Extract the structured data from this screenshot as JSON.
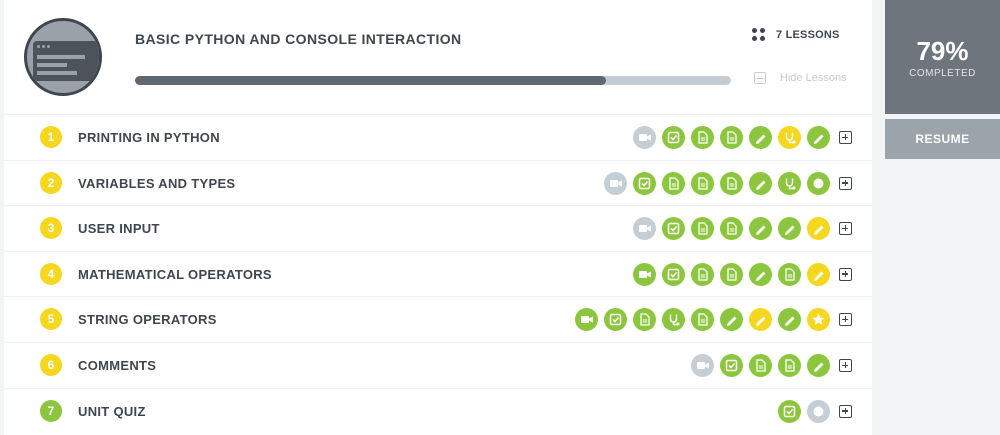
{
  "course": {
    "title": "BASIC PYTHON AND CONSOLE INTERACTION",
    "lessons_label": "7 LESSONS",
    "hide_label": "Hide Lessons",
    "progress": 0.79
  },
  "status": {
    "percent": "79%",
    "completed_label": "COMPLETED",
    "resume_label": "RESUME"
  },
  "colors": {
    "green": "#8cc63f",
    "yellow": "#f5d71f",
    "gray": "#c5cdd5",
    "dark": "#3f464e"
  },
  "lessons": [
    {
      "number": "1",
      "name": "PRINTING IN PYTHON",
      "badge": "yellow",
      "icons": [
        {
          "name": "video-icon",
          "state": "gray"
        },
        {
          "name": "check-icon",
          "state": "green"
        },
        {
          "name": "document-icon",
          "state": "green"
        },
        {
          "name": "document-icon",
          "state": "green"
        },
        {
          "name": "pencil-icon",
          "state": "green"
        },
        {
          "name": "stethoscope-icon",
          "state": "yellow"
        },
        {
          "name": "pencil-icon",
          "state": "green"
        }
      ]
    },
    {
      "number": "2",
      "name": "VARIABLES AND TYPES",
      "badge": "yellow",
      "icons": [
        {
          "name": "video-icon",
          "state": "gray"
        },
        {
          "name": "check-icon",
          "state": "green"
        },
        {
          "name": "document-icon",
          "state": "green"
        },
        {
          "name": "document-icon",
          "state": "green"
        },
        {
          "name": "document-icon",
          "state": "green"
        },
        {
          "name": "pencil-icon",
          "state": "green"
        },
        {
          "name": "stethoscope-icon",
          "state": "green"
        },
        {
          "name": "circle-icon",
          "state": "green"
        }
      ]
    },
    {
      "number": "3",
      "name": "USER INPUT",
      "badge": "yellow",
      "icons": [
        {
          "name": "video-icon",
          "state": "gray"
        },
        {
          "name": "check-icon",
          "state": "green"
        },
        {
          "name": "document-icon",
          "state": "green"
        },
        {
          "name": "document-icon",
          "state": "green"
        },
        {
          "name": "pencil-icon",
          "state": "green"
        },
        {
          "name": "pencil-icon",
          "state": "green"
        },
        {
          "name": "pencil-icon",
          "state": "yellow"
        }
      ]
    },
    {
      "number": "4",
      "name": "MATHEMATICAL OPERATORS",
      "badge": "yellow",
      "icons": [
        {
          "name": "video-icon",
          "state": "green"
        },
        {
          "name": "check-icon",
          "state": "green"
        },
        {
          "name": "document-icon",
          "state": "green"
        },
        {
          "name": "document-icon",
          "state": "green"
        },
        {
          "name": "pencil-icon",
          "state": "green"
        },
        {
          "name": "document-icon",
          "state": "green"
        },
        {
          "name": "pencil-icon",
          "state": "yellow"
        }
      ]
    },
    {
      "number": "5",
      "name": "STRING OPERATORS",
      "badge": "yellow",
      "icons": [
        {
          "name": "video-icon",
          "state": "green"
        },
        {
          "name": "check-icon",
          "state": "green"
        },
        {
          "name": "document-icon",
          "state": "green"
        },
        {
          "name": "stethoscope-icon",
          "state": "green"
        },
        {
          "name": "document-icon",
          "state": "green"
        },
        {
          "name": "pencil-icon",
          "state": "green"
        },
        {
          "name": "pencil-icon",
          "state": "yellow"
        },
        {
          "name": "pencil-icon",
          "state": "green"
        },
        {
          "name": "star-icon",
          "state": "yellow"
        }
      ]
    },
    {
      "number": "6",
      "name": "COMMENTS",
      "badge": "yellow",
      "icons": [
        {
          "name": "video-icon",
          "state": "gray"
        },
        {
          "name": "check-icon",
          "state": "green"
        },
        {
          "name": "document-icon",
          "state": "green"
        },
        {
          "name": "document-icon",
          "state": "green"
        },
        {
          "name": "pencil-icon",
          "state": "green"
        }
      ]
    },
    {
      "number": "7",
      "name": "UNIT QUIZ",
      "badge": "green",
      "icons": [
        {
          "name": "check-icon",
          "state": "green"
        },
        {
          "name": "circle-icon",
          "state": "gray"
        }
      ]
    }
  ]
}
